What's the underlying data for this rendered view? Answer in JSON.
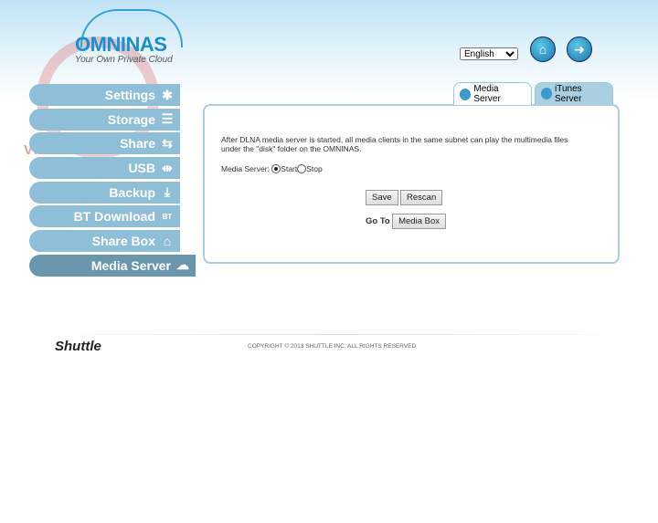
{
  "header": {
    "logo_name": "OMNINAS",
    "logo_tagline": "Your Own Private Cloud",
    "watermark": "VMODTECH.COM",
    "language": "English",
    "home_icon": "home-icon",
    "logout_icon": "logout-icon"
  },
  "sidebar": {
    "items": [
      {
        "label": "Settings",
        "icon": "✱"
      },
      {
        "label": "Storage",
        "icon": "☰"
      },
      {
        "label": "Share",
        "icon": "⇆"
      },
      {
        "label": "USB",
        "icon": "⇹"
      },
      {
        "label": "Backup",
        "icon": "⤓"
      },
      {
        "label": "BT Download",
        "icon": "BT"
      },
      {
        "label": "Share Box",
        "icon": "⌂"
      },
      {
        "label": "Media Server",
        "icon": "☁"
      }
    ],
    "active": "Media Server"
  },
  "tabs": [
    {
      "label": "Media Server",
      "active": true
    },
    {
      "label": "iTunes Server",
      "active": false
    }
  ],
  "content": {
    "description": "After DLNA media server is started, all media clients in the same subnet can play the multimedia files under the \"disk\" folder on the OMNINAS.",
    "media_server_label": "Media Server:",
    "start_label": "Start",
    "stop_label": "Stop",
    "selected": "Start",
    "save": "Save",
    "rescan": "Rescan",
    "goto_label": "Go To",
    "media_box": "Media Box"
  },
  "footer": {
    "brand": "Shuttle",
    "copyright": "COPYRIGHT © 2013 SHUTTLE INC. ALL RIGHTS RESERVED"
  }
}
